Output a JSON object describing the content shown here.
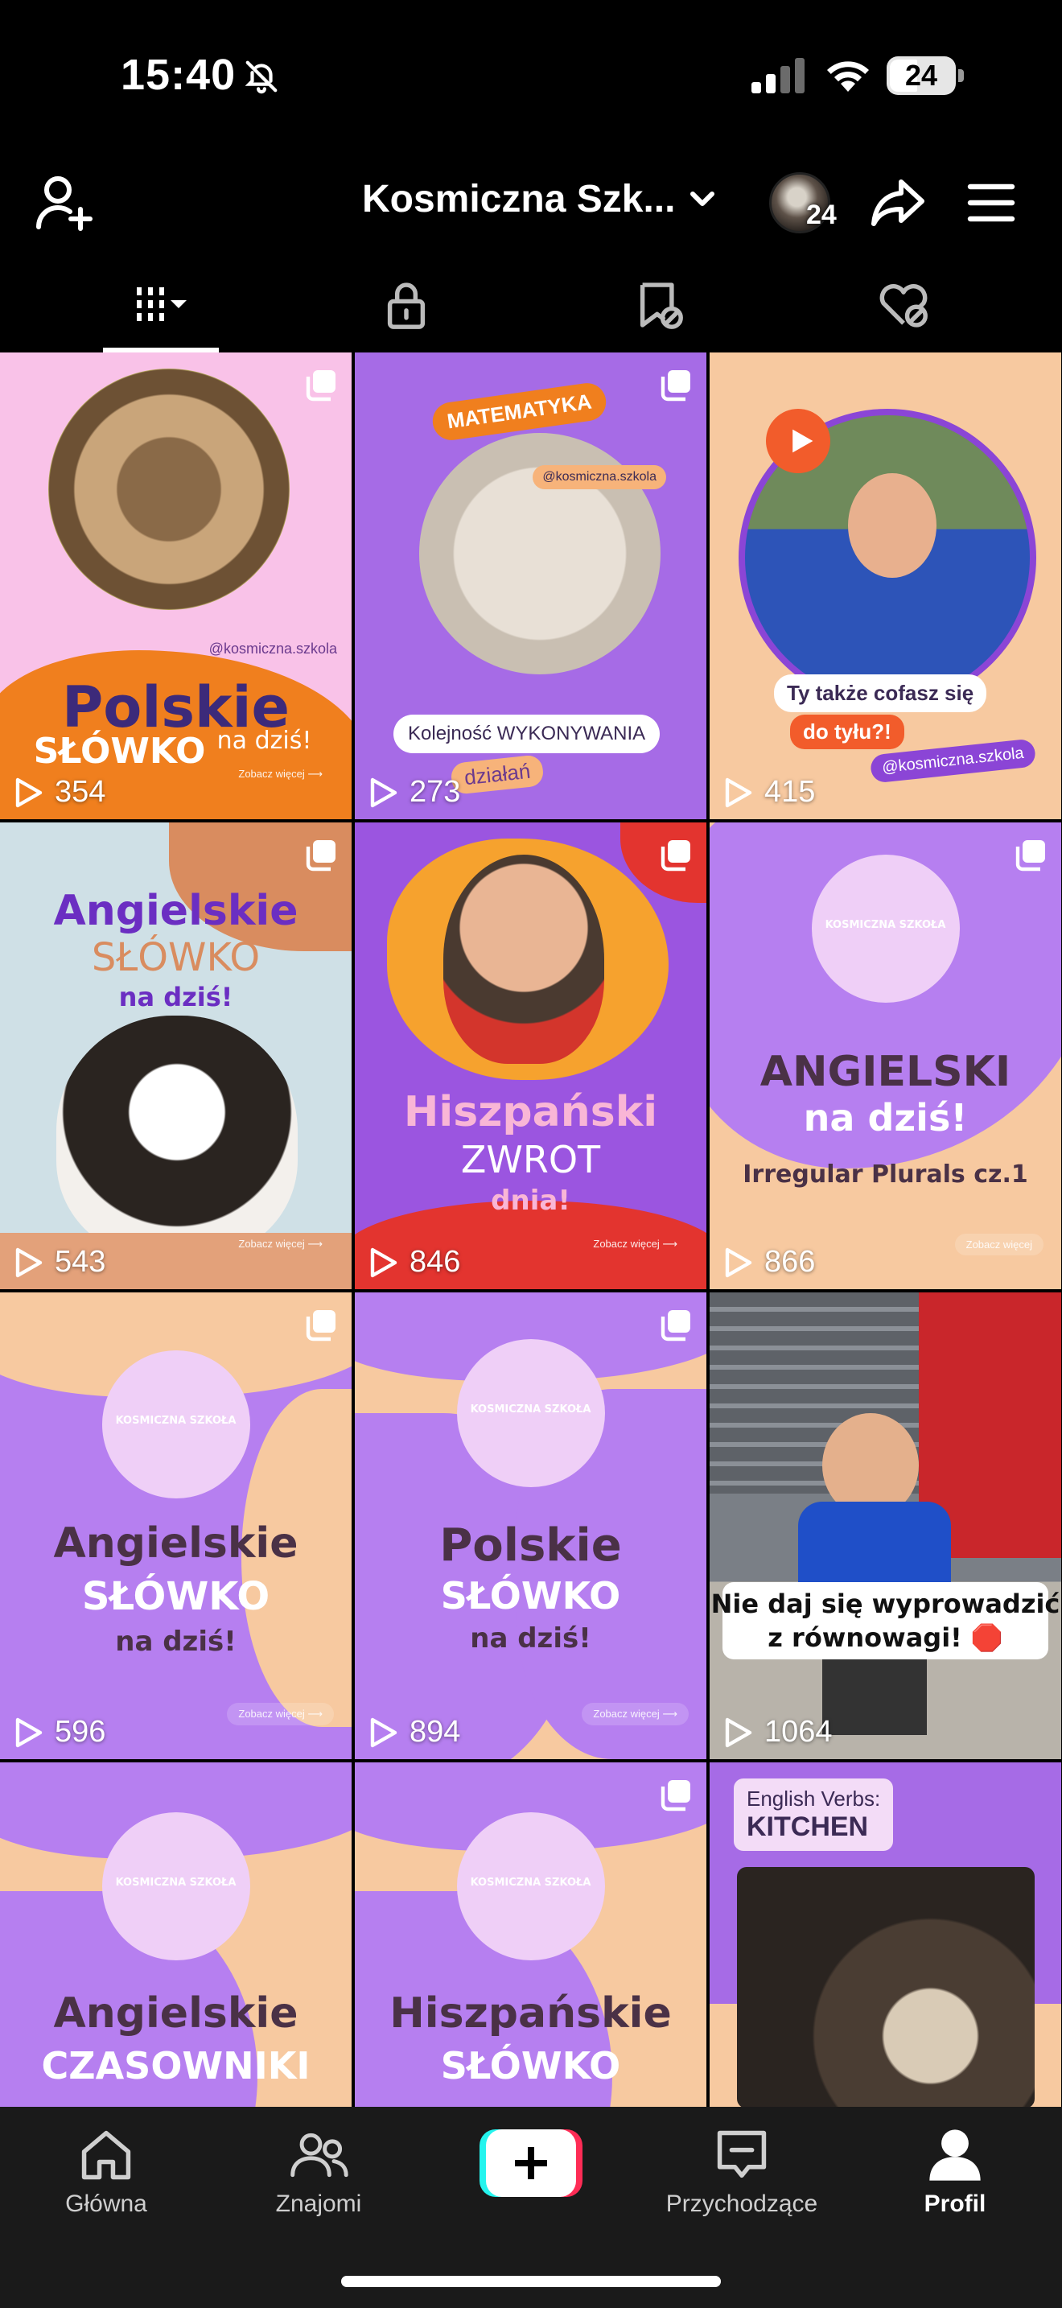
{
  "status_bar": {
    "time": "15:40",
    "battery": "24",
    "icons": [
      "bell-slash-icon",
      "cellular-signal-icon",
      "wifi-icon",
      "battery-icon"
    ]
  },
  "header": {
    "account_name": "Kosmiczna Szk...",
    "story_count": "24",
    "icons": [
      "add-friend-icon",
      "chevron-down-icon",
      "share-icon",
      "menu-icon"
    ]
  },
  "tabs": [
    {
      "name": "videos",
      "icon": "grid-icon"
    },
    {
      "name": "private",
      "icon": "lock-icon"
    },
    {
      "name": "reposts",
      "icon": "repost-icon"
    },
    {
      "name": "liked",
      "icon": "liked-icon"
    }
  ],
  "grid": {
    "tiles": [
      {
        "views": "354",
        "lines": [
          "Polskie",
          "SŁÓWKO",
          "na dziś!"
        ],
        "handle": "@kosmiczna.szkola",
        "cta": "Zobacz więcej ⟶"
      },
      {
        "views": "273",
        "lines": [
          "MATEMATYKA",
          "Kolejność WYKONYWANIA",
          "działań"
        ],
        "handle": "@kosmiczna.szkola"
      },
      {
        "views": "415",
        "lines": [
          "Ty także cofasz się",
          "do tyłu?!"
        ],
        "handle": "@kosmiczna.szkola"
      },
      {
        "views": "543",
        "lines": [
          "Angielskie",
          "SŁÓWKO",
          "na dziś!"
        ],
        "cta": "Zobacz więcej ⟶"
      },
      {
        "views": "846",
        "lines": [
          "Hiszpański",
          "ZWROT",
          "dnia!"
        ],
        "cta": "Zobacz więcej ⟶"
      },
      {
        "views": "866",
        "lines": [
          "ANGIELSKI",
          "na dziś!",
          "Irregular Plurals cz.1"
        ],
        "cta": "Zobacz więcej"
      },
      {
        "views": "596",
        "lines": [
          "Angielskie",
          "SŁÓWKO",
          "na dziś!"
        ],
        "cta": "Zobacz więcej ⟶"
      },
      {
        "views": "894",
        "lines": [
          "Polskie",
          "SŁÓWKO",
          "na dziś!"
        ],
        "cta": "Zobacz więcej ⟶"
      },
      {
        "views": "1064",
        "lines": [
          "Nie daj się wyprowadzić",
          "z równowagi! 🛑"
        ]
      },
      {
        "views": "",
        "lines": [
          "Angielskie",
          "CZASOWNIKI"
        ]
      },
      {
        "views": "",
        "lines": [
          "Hiszpańskie",
          "SŁÓWKO"
        ]
      },
      {
        "views": "",
        "lines": [
          "English Verbs:",
          "KITCHEN"
        ]
      }
    ],
    "mascot_badge": "KOSMICZNA SZKOŁA"
  },
  "bottom_nav": {
    "items": [
      {
        "label": "Główna",
        "icon": "home-icon"
      },
      {
        "label": "Znajomi",
        "icon": "friends-icon"
      },
      {
        "label": "",
        "icon": "create-plus-icon"
      },
      {
        "label": "Przychodzące",
        "icon": "inbox-icon"
      },
      {
        "label": "Profil",
        "icon": "profile-icon"
      }
    ]
  },
  "colors": {
    "background": "#000000",
    "nav_bg": "#1a1a1a",
    "purple": "#a66be6",
    "peach": "#f7c9a0",
    "orange": "#f07f1e",
    "pink": "#f9c2e8",
    "red": "#e3342f",
    "create_cyan": "#25f4ee",
    "create_red": "#fe2c55"
  }
}
